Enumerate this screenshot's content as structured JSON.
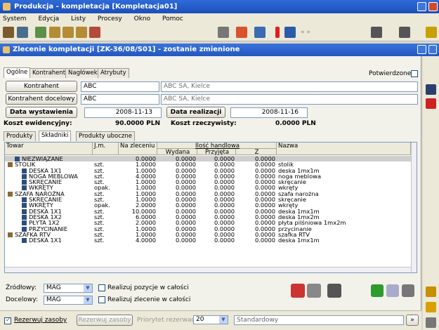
{
  "window": {
    "title": "Produkcja - kompletacja [Kompletacja01]"
  },
  "menu": [
    "System",
    "Edycja",
    "Listy",
    "Procesy",
    "Okno",
    "Pomoc"
  ],
  "document": {
    "title": "Zlecenie kompletacji [ZK-36/08/S01] - zostanie zmienione"
  },
  "tabs": [
    "Ogólne",
    "Kontrahent",
    "Nagłówek",
    "Atrybuty"
  ],
  "confirmed_label": "Potwierdzone",
  "form": {
    "kontrahent_label": "Kontrahent",
    "kontrahent_code": "ABC",
    "kontrahent_name": "ABC SA, Kielce",
    "kontrahent_docelowy_label": "Kontrahent docelowy",
    "kontrahent_docelowy_code": "ABC",
    "kontrahent_docelowy_name": "ABC SA, Kielce",
    "data_wystawienia_label": "Data wystawienia",
    "data_wystawienia": "2008-11-13",
    "data_realizacji_label": "Data realizacji",
    "data_realizacji": "2008-11-16",
    "koszt_ewidencyjny_label": "Koszt ewidencyjny:",
    "koszt_ewidencyjny": "90.0000 PLN",
    "koszt_rzeczywisty_label": "Koszt rzeczywisty:",
    "koszt_rzeczywisty": "0.0000 PLN"
  },
  "subtabs": [
    "Produkty",
    "Składniki",
    "Produkty uboczne"
  ],
  "grid": {
    "headers": {
      "towar": "Towar",
      "jm": "J.m.",
      "na_zleceniu": "Na zleceniu",
      "ilosc_handlowa": "Ilość handlowa",
      "wydana": "Wydana",
      "przyjeta": "Przyjęta",
      "z_zamiennikow": "Z zamienników",
      "nazwa": "Nazwa"
    },
    "rows": [
      {
        "towar": "NIEZWIĄZANE",
        "jm": "",
        "na": "0.0000",
        "w": "0.0000",
        "p": "0.0000",
        "z": "0.0000",
        "nazwa": "",
        "level": 1,
        "sel": true
      },
      {
        "towar": "STOLIK",
        "jm": "szt.",
        "na": "1.0000",
        "w": "0.0000",
        "p": "0.0000",
        "z": "0.0000",
        "nazwa": "stolik",
        "level": 0
      },
      {
        "towar": "DESKA 1X1",
        "jm": "szt.",
        "na": "1.0000",
        "w": "0.0000",
        "p": "0.0000",
        "z": "0.0000",
        "nazwa": "deska 1mx1m",
        "level": 2
      },
      {
        "towar": "NOGA MEBLOWA",
        "jm": "szt.",
        "na": "4.0000",
        "w": "0.0000",
        "p": "0.0000",
        "z": "0.0000",
        "nazwa": "noga meblowa",
        "level": 2
      },
      {
        "towar": "SKRĘCANIE",
        "jm": "szt.",
        "na": "1.0000",
        "w": "0.0000",
        "p": "0.0000",
        "z": "0.0000",
        "nazwa": "skręcanie",
        "level": 2
      },
      {
        "towar": "WKRĘTY",
        "jm": "opak.",
        "na": "1.0000",
        "w": "0.0000",
        "p": "0.0000",
        "z": "0.0000",
        "nazwa": "wkręty",
        "level": 2
      },
      {
        "towar": "SZAFA NAROŻNA",
        "jm": "szt.",
        "na": "1.0000",
        "w": "0.0000",
        "p": "0.0000",
        "z": "0.0000",
        "nazwa": "szafa narożna",
        "level": 0
      },
      {
        "towar": "SKRĘCANIE",
        "jm": "szt.",
        "na": "1.0000",
        "w": "0.0000",
        "p": "0.0000",
        "z": "0.0000",
        "nazwa": "skręcanie",
        "level": 2
      },
      {
        "towar": "WKRĘTY",
        "jm": "opak.",
        "na": "2.0000",
        "w": "0.0000",
        "p": "0.0000",
        "z": "0.0000",
        "nazwa": "wkręty",
        "level": 2
      },
      {
        "towar": "DESKA 1X1",
        "jm": "szt.",
        "na": "10.0000",
        "w": "0.0000",
        "p": "0.0000",
        "z": "0.0000",
        "nazwa": "deska 1mx1m",
        "level": 2
      },
      {
        "towar": "DESKA 1X2",
        "jm": "szt.",
        "na": "6.0000",
        "w": "0.0000",
        "p": "0.0000",
        "z": "0.0000",
        "nazwa": "deska 1mx2m",
        "level": 2
      },
      {
        "towar": "PŁYTA 1X2",
        "jm": "szt.",
        "na": "2.0000",
        "w": "0.0000",
        "p": "0.0000",
        "z": "0.0000",
        "nazwa": "płyta pilśniowa 1mx2m",
        "level": 2
      },
      {
        "towar": "PRZYCINANIE",
        "jm": "szt.",
        "na": "1.0000",
        "w": "0.0000",
        "p": "0.0000",
        "z": "0.0000",
        "nazwa": "przycinanie",
        "level": 2
      },
      {
        "towar": "SZAFKA RTV",
        "jm": "szt.",
        "na": "1.0000",
        "w": "0.0000",
        "p": "0.0000",
        "z": "0.0000",
        "nazwa": "szafka RTV",
        "level": 0
      },
      {
        "towar": "DESKA 1X1",
        "jm": "szt.",
        "na": "4.0000",
        "w": "0.0000",
        "p": "0.0000",
        "z": "0.0000",
        "nazwa": "deska 1mx1m",
        "level": 2
      }
    ]
  },
  "bottom": {
    "zrodlowy_label": "Źródłowy:",
    "zrodlowy_value": "MAG",
    "docelowy_label": "Docelowy:",
    "docelowy_value": "MAG",
    "realizuj_pozycje_label": "Realizuj pozycje w całości",
    "realizuj_zlecenie_label": "Realizuj zlecenie w całości",
    "rezerwuj_label": "Rezerwuj zasoby",
    "rezerwuj_button": "Rezerwuj zasoby",
    "priorytet_label": "Priorytet rezerwacji:",
    "priorytet_value": "20",
    "standardowy_value": "Standardowy"
  }
}
